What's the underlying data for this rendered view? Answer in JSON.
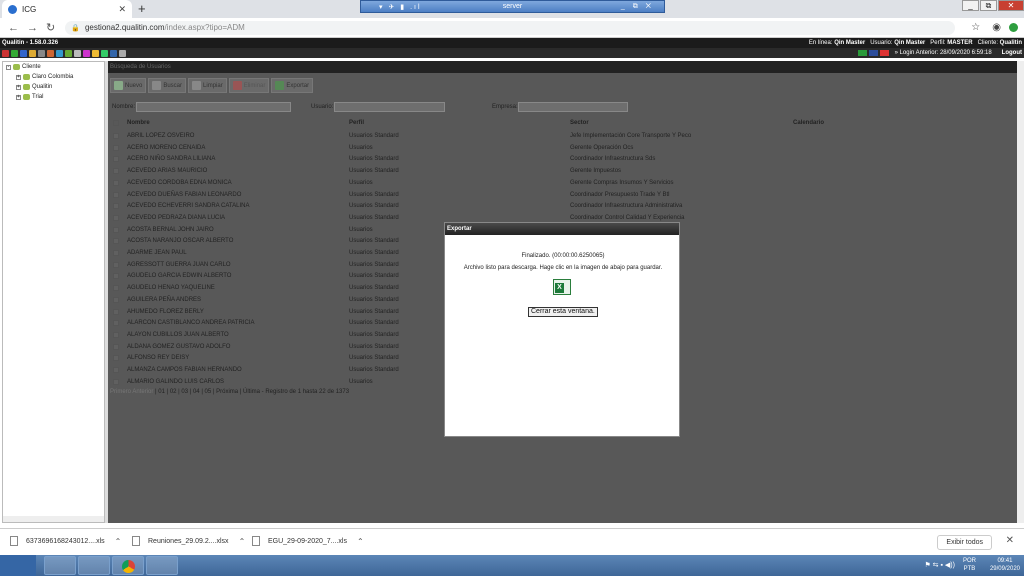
{
  "browser": {
    "tab_title": "ICG",
    "remote_title": "server",
    "url_domain": "gestiona2.qualitin.com",
    "url_path": "/index.aspx?tipo=ADM"
  },
  "app": {
    "version": "Qualitin - 1.58.0.326",
    "status_online_label": "En línea:",
    "status_online_value": "Qin Master",
    "user_label": "Usuario:",
    "user_value": "Qin Master",
    "profile_label": "Perfil:",
    "profile_value": "MASTER",
    "client_label": "Cliente:",
    "client_value": "Qualitin",
    "last_login": "» Login Anterior: 28/09/2020 6:59:18",
    "logout": "Logout"
  },
  "tree": {
    "root": "Cliente",
    "children": [
      "Claro Colombia",
      "Qualitin",
      "Trial"
    ]
  },
  "panel": {
    "title": "Búsqueda de Usuarios",
    "toolbar": [
      "Nuevo",
      "Buscar",
      "Limpiar",
      "Eliminar",
      "Exportar"
    ],
    "filter_nombre": "Nombre:",
    "filter_usuario": "Usuario:",
    "filter_empresa": "Empresa:",
    "columns": [
      "Nombre",
      "Perfil",
      "Sector",
      "Calendario"
    ]
  },
  "rows": [
    {
      "name": "ABRIL LOPEZ OSVEIRO",
      "perfil": "Usuarios Standard",
      "sector": "Jefe Implementación Core Transporte Y Peco"
    },
    {
      "name": "ACERO MORENO CENAIDA",
      "perfil": "Usuarios",
      "sector": "Gerente Operación Ocs"
    },
    {
      "name": "ACERO NIÑO SANDRA LILIANA",
      "perfil": "Usuarios Standard",
      "sector": "Coordinador Infraestructura Sds"
    },
    {
      "name": "ACEVEDO ARIAS MAURICIO",
      "perfil": "Usuarios Standard",
      "sector": "Gerente Impuestos"
    },
    {
      "name": "ACEVEDO CORDOBA EDNA MONICA",
      "perfil": "Usuarios",
      "sector": "Gerente Compras Insumos Y Servicios"
    },
    {
      "name": "ACEVEDO DUEÑAS FABIAN LEONARDO",
      "perfil": "Usuarios Standard",
      "sector": "Coordinador Presupuesto Trade Y Btl"
    },
    {
      "name": "ACEVEDO ECHEVERRI SANDRA CATALINA",
      "perfil": "Usuarios Standard",
      "sector": "Coordinador Infraestructura Administrativa"
    },
    {
      "name": "ACEVEDO PEDRAZA DIANA LUCIA",
      "perfil": "Usuarios Standard",
      "sector": "Coordinador Control Calidad Y Experiencia"
    },
    {
      "name": "ACOSTA BERNAL JOHN JAIRO",
      "perfil": "Usuarios",
      "sector": ""
    },
    {
      "name": "ACOSTA NARANJO OSCAR ALBERTO",
      "perfil": "Usuarios Standard",
      "sector": ""
    },
    {
      "name": "ADARME JEAN PAUL",
      "perfil": "Usuarios Standard",
      "sector": ""
    },
    {
      "name": "AGRESSOTT GUERRA JUAN CARLO",
      "perfil": "Usuarios Standard",
      "sector": ""
    },
    {
      "name": "AGUDELO GARCIA EDWIN ALBERTO",
      "perfil": "Usuarios Standard",
      "sector": ""
    },
    {
      "name": "AGUDELO HENAO YAQUELINE",
      "perfil": "Usuarios Standard",
      "sector": ""
    },
    {
      "name": "AGUILERA PEÑA ANDRES",
      "perfil": "Usuarios Standard",
      "sector": ""
    },
    {
      "name": "AHUMEDO FLOREZ BERLY",
      "perfil": "Usuarios Standard",
      "sector": "entas"
    },
    {
      "name": "ALARCON CASTIBLANCO ANDREA PATRICIA",
      "perfil": "Usuarios Standard",
      "sector": ""
    },
    {
      "name": "ALAYON CUBILLOS JUAN ALBERTO",
      "perfil": "Usuarios Standard",
      "sector": ""
    },
    {
      "name": "ALDANA GOMEZ GUSTAVO ADOLFO",
      "perfil": "Usuarios Standard",
      "sector": ""
    },
    {
      "name": "ALFONSO REY DEISY",
      "perfil": "Usuarios Standard",
      "sector": ""
    },
    {
      "name": "ALMANZA CAMPOS FABIAN HERNANDO",
      "perfil": "Usuarios Standard",
      "sector": ""
    },
    {
      "name": "ALMARIO GALINDO LUIS CARLOS",
      "perfil": "Usuarios",
      "sector": "s Y Negocios"
    }
  ],
  "pager": {
    "first": "Primero",
    "prev": "Anterior",
    "pages": "| 01 | 02 | 03 | 04 | 05 |",
    "rest": "Próxima | Última - Registro de 1 hasta 22 de 1373"
  },
  "dialog": {
    "title": "Exportar",
    "status": "Finalizado. (00:00:00.6250065)",
    "message": "Archivo listo para descarga. Hage clic en la imagen de abajo para guardar.",
    "close": "Cerrar esta ventana."
  },
  "downloads": {
    "items": [
      "63736961682430​12....xls",
      "Reuniones_29.09.2....xlsx",
      "EGU_29-09-2020_7....xls"
    ],
    "show_all": "Exibir todos"
  },
  "taskbar": {
    "lang": "POR",
    "layout": "PTB",
    "time": "09:41",
    "date": "29/09/2020"
  }
}
